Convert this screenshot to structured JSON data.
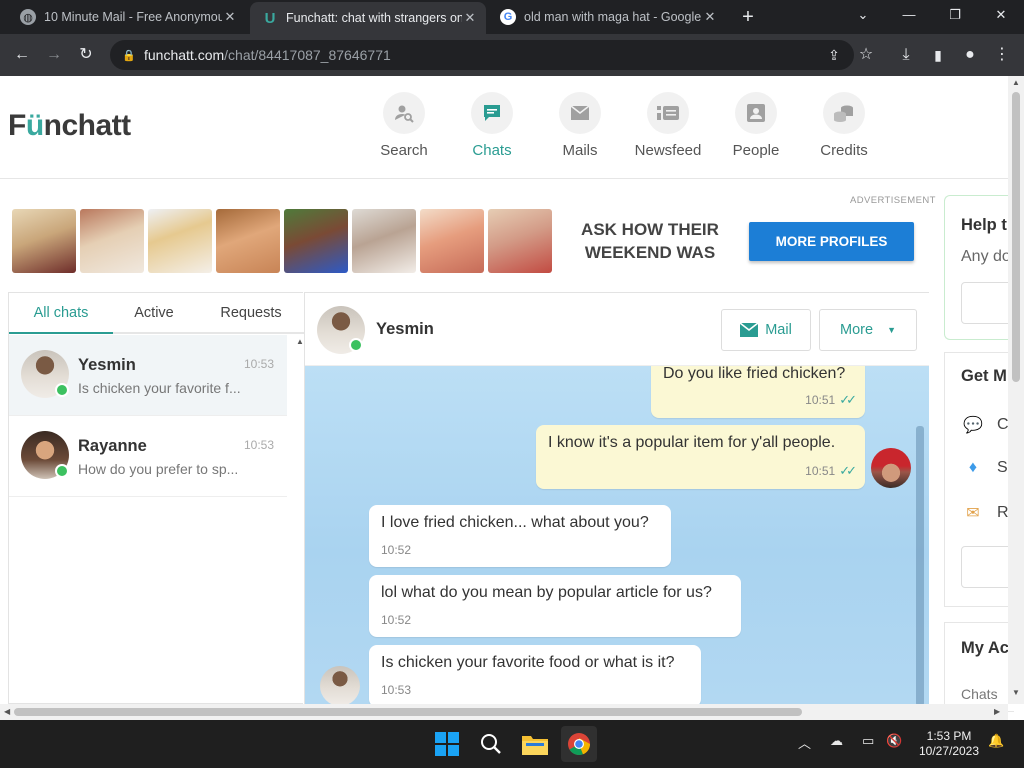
{
  "browser": {
    "tabs": [
      {
        "title": "10 Minute Mail - Free Anonymou",
        "active": false
      },
      {
        "title": "Funchatt: chat with strangers onl",
        "active": true
      },
      {
        "title": "old man with maga hat - Google",
        "active": false
      }
    ],
    "url_host": "funchatt.com",
    "url_path": "/chat/84417087_87646771"
  },
  "site": {
    "logo_prefix": "F",
    "logo_u": "ü",
    "logo_rest": "nchatt",
    "nav": [
      {
        "label": "Search",
        "icon": "user-search-icon"
      },
      {
        "label": "Chats",
        "icon": "chat-icon"
      },
      {
        "label": "Mails",
        "icon": "mail-icon"
      },
      {
        "label": "Newsfeed",
        "icon": "newsfeed-icon"
      },
      {
        "label": "People",
        "icon": "people-icon"
      },
      {
        "label": "Credits",
        "icon": "credits-icon"
      }
    ]
  },
  "ad": {
    "label": "ADVERTISEMENT",
    "line1": "ASK HOW THEIR",
    "line2": "WEEKEND WAS",
    "button": "MORE PROFILES"
  },
  "chat_list": {
    "tabs": [
      "All chats",
      "Active",
      "Requests"
    ],
    "items": [
      {
        "name": "Yesmin",
        "time": "10:53",
        "preview": "Is chicken your favorite f..."
      },
      {
        "name": "Rayanne",
        "time": "10:53",
        "preview": "How do you prefer to sp..."
      }
    ]
  },
  "conversation": {
    "name": "Yesmin",
    "mail_label": "Mail",
    "more_label": "More",
    "messages": [
      {
        "dir": "out",
        "text": "Do you like fried chicken?",
        "time": "10:51"
      },
      {
        "dir": "out",
        "text": "I know it's a popular item for y'all people.",
        "time": "10:51"
      },
      {
        "dir": "in",
        "text": "I love fried chicken... what about you?",
        "time": "10:52"
      },
      {
        "dir": "in",
        "text": "lol what do you mean by popular article for us?",
        "time": "10:52"
      },
      {
        "dir": "in",
        "text": "Is chicken your favorite food or what is it?",
        "time": "10:53"
      }
    ]
  },
  "right": {
    "help_title": "Help t",
    "help_sub": "Any do",
    "get_title": "Get M",
    "get_items": [
      "C",
      "Se",
      "R"
    ],
    "account_title": "My Ac",
    "account_row": "Chats"
  },
  "taskbar": {
    "time": "1:53 PM",
    "date": "10/27/2023"
  }
}
